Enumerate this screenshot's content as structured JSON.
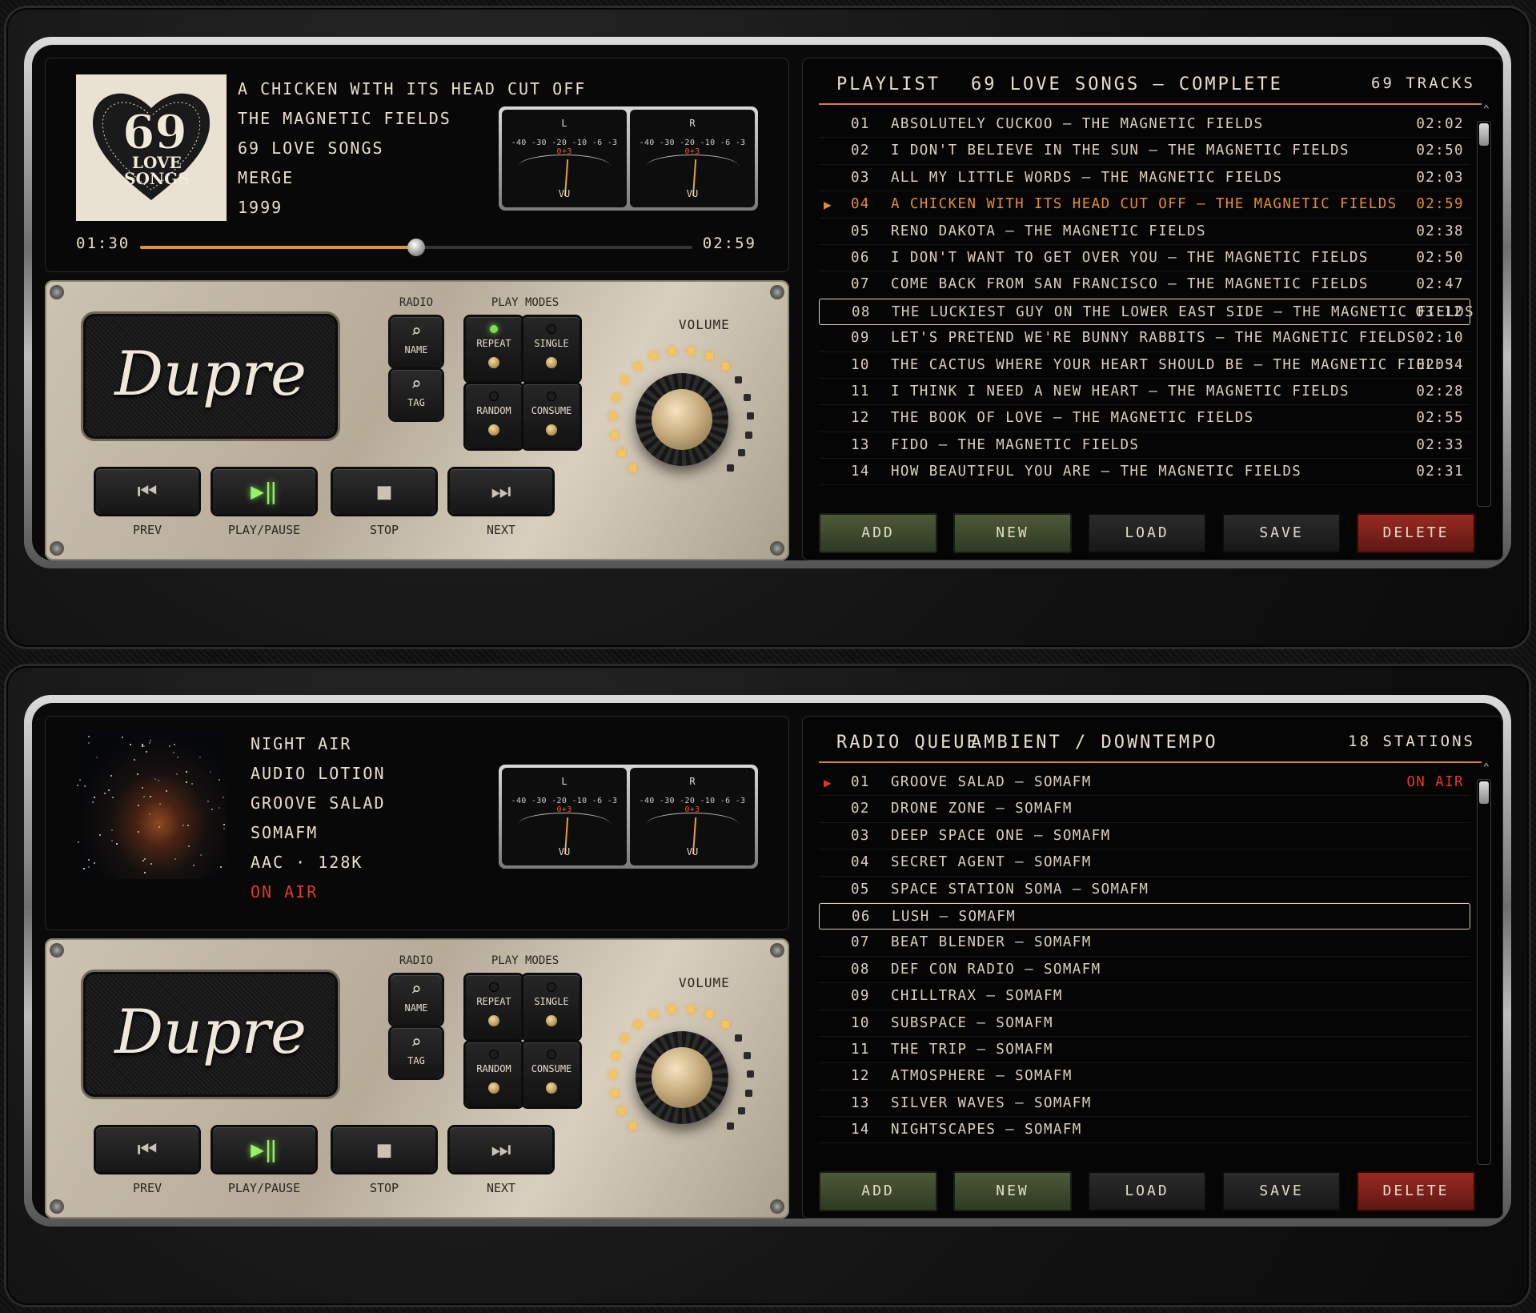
{
  "brand": "Dupre",
  "labels": {
    "radio": "RADIO",
    "play_modes": "PLAY MODES",
    "volume": "VOLUME",
    "name": "NAME",
    "tag": "TAG",
    "repeat": "REPEAT",
    "single": "SINGLE",
    "random": "RANDOM",
    "consume": "CONSUME",
    "prev": "PREV",
    "play_pause": "PLAY/PAUSE",
    "stop": "STOP",
    "next": "NEXT",
    "vu_left": "L",
    "vu_right": "R",
    "vu": "VU",
    "vu_scale": "-40 -30 -20 -10 -6 -3",
    "vu_peak": "0+3"
  },
  "icons": {
    "search": "search-icon",
    "prev": "skip-back-icon",
    "play": "play-pause-icon",
    "stop": "stop-icon",
    "next": "skip-forward-icon"
  },
  "colors": {
    "accent": "#e0952d",
    "live": "#e2382b",
    "led_on": "#7be04f"
  },
  "player1": {
    "art": {
      "number": "69",
      "line1": "LOVE",
      "line2": "SONGS"
    },
    "info": [
      "A CHICKEN WITH ITS HEAD CUT OFF",
      "THE MAGNETIC FIELDS",
      "69 LOVE SONGS",
      "MERGE",
      "1999"
    ],
    "elapsed": "01:30",
    "duration": "02:59",
    "progress": 0.5,
    "modes": {
      "repeat": true,
      "single": false,
      "random": false,
      "consume": false
    },
    "volume_level": 0.68,
    "playlist": {
      "title": "PLAYLIST",
      "name": "69 LOVE SONGS — COMPLETE",
      "count": "69 TRACKS",
      "rows": [
        {
          "n": "01",
          "t": "ABSOLUTELY CUCKOO — THE MAGNETIC FIELDS",
          "d": "02:02"
        },
        {
          "n": "02",
          "t": "I DON'T BELIEVE IN THE SUN — THE MAGNETIC FIELDS",
          "d": "02:50"
        },
        {
          "n": "03",
          "t": "ALL MY LITTLE WORDS — THE MAGNETIC FIELDS",
          "d": "02:03"
        },
        {
          "n": "04",
          "t": "A CHICKEN WITH ITS HEAD CUT OFF — THE MAGNETIC FIELDS",
          "d": "02:59",
          "current": true
        },
        {
          "n": "05",
          "t": "RENO DAKOTA — THE MAGNETIC FIELDS",
          "d": "02:38"
        },
        {
          "n": "06",
          "t": "I DON'T WANT TO GET OVER YOU — THE MAGNETIC FIELDS",
          "d": "02:50"
        },
        {
          "n": "07",
          "t": "COME BACK FROM SAN FRANCISCO — THE MAGNETIC FIELDS",
          "d": "02:47"
        },
        {
          "n": "08",
          "t": "THE LUCKIEST GUY ON THE LOWER EAST SIDE — THE MAGNETIC FIELDS",
          "d": "03:12",
          "selected": true
        },
        {
          "n": "09",
          "t": "LET'S PRETEND WE'RE BUNNY RABBITS — THE MAGNETIC FIELDS",
          "d": "02:10"
        },
        {
          "n": "10",
          "t": "THE CACTUS WHERE YOUR HEART SHOULD BE — THE MAGNETIC FIELDS",
          "d": "02:34"
        },
        {
          "n": "11",
          "t": "I THINK I NEED A NEW HEART — THE MAGNETIC FIELDS",
          "d": "02:28"
        },
        {
          "n": "12",
          "t": "THE BOOK OF LOVE — THE MAGNETIC FIELDS",
          "d": "02:55"
        },
        {
          "n": "13",
          "t": "FIDO — THE MAGNETIC FIELDS",
          "d": "02:33"
        },
        {
          "n": "14",
          "t": "HOW BEAUTIFUL YOU ARE — THE MAGNETIC FIELDS",
          "d": "02:31"
        }
      ]
    },
    "buttons": [
      "ADD",
      "NEW",
      "LOAD",
      "SAVE",
      "DELETE"
    ]
  },
  "player2": {
    "info": [
      "NIGHT AIR",
      "AUDIO LOTION",
      "GROOVE SALAD",
      "SOMAFM",
      "AAC · 128K"
    ],
    "status": "ON AIR",
    "modes": {
      "repeat": false,
      "single": false,
      "random": false,
      "consume": false
    },
    "volume_level": 0.68,
    "playlist": {
      "title": "RADIO QUEUE",
      "name": "AMBIENT / DOWNTEMPO",
      "count": "18 STATIONS",
      "rows": [
        {
          "n": "01",
          "t": "GROOVE SALAD  —  SOMAFM",
          "status": "ON AIR",
          "current": true
        },
        {
          "n": "02",
          "t": "DRONE ZONE  —  SOMAFM"
        },
        {
          "n": "03",
          "t": "DEEP SPACE ONE  —  SOMAFM"
        },
        {
          "n": "04",
          "t": "SECRET AGENT  —  SOMAFM"
        },
        {
          "n": "05",
          "t": "SPACE STATION SOMA  —  SOMAFM"
        },
        {
          "n": "06",
          "t": "LUSH  —  SOMAFM",
          "selected": true
        },
        {
          "n": "07",
          "t": "BEAT BLENDER  —  SOMAFM"
        },
        {
          "n": "08",
          "t": "DEF CON RADIO  —  SOMAFM"
        },
        {
          "n": "09",
          "t": "CHILLTRAX  —  SOMAFM"
        },
        {
          "n": "10",
          "t": "SUBSPACE  —  SOMAFM"
        },
        {
          "n": "11",
          "t": "THE TRIP  —  SOMAFM"
        },
        {
          "n": "12",
          "t": "ATMOSPHERE  —  SOMAFM"
        },
        {
          "n": "13",
          "t": "SILVER WAVES  —  SOMAFM"
        },
        {
          "n": "14",
          "t": "NIGHTSCAPES  —  SOMAFM"
        }
      ]
    },
    "buttons": [
      "ADD",
      "NEW",
      "LOAD",
      "SAVE",
      "DELETE"
    ]
  }
}
